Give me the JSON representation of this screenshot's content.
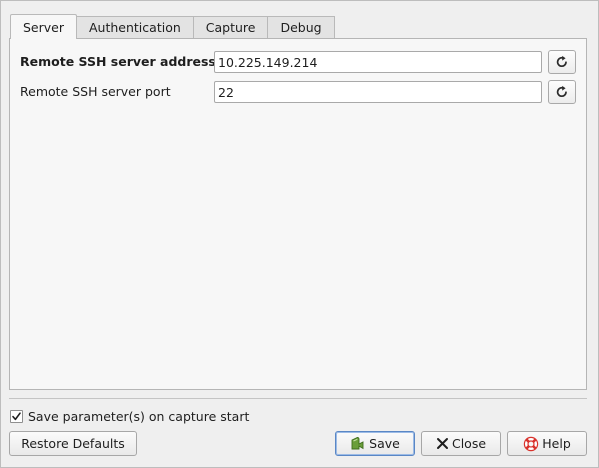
{
  "tabs": [
    {
      "label": "Server",
      "active": true
    },
    {
      "label": "Authentication",
      "active": false
    },
    {
      "label": "Capture",
      "active": false
    },
    {
      "label": "Debug",
      "active": false
    }
  ],
  "server": {
    "address_label": "Remote SSH server address",
    "address_value": "10.225.149.214",
    "port_label": "Remote SSH server port",
    "port_value": "22",
    "reset_icon": "refresh-icon"
  },
  "options": {
    "save_on_start_label": "Save parameter(s) on capture start",
    "save_on_start_checked": true
  },
  "buttons": {
    "restore_defaults": "Restore Defaults",
    "save": "Save",
    "close": "Close",
    "help": "Help"
  },
  "icons": {
    "save": "save-icon",
    "close": "close-icon",
    "help": "help-icon"
  },
  "colors": {
    "window_bg": "#efefef",
    "panel_bg": "#f7f7f7",
    "default_button_border": "#5a87c5",
    "help_icon": "#d9322c",
    "save_icon": "#4a7a24"
  }
}
